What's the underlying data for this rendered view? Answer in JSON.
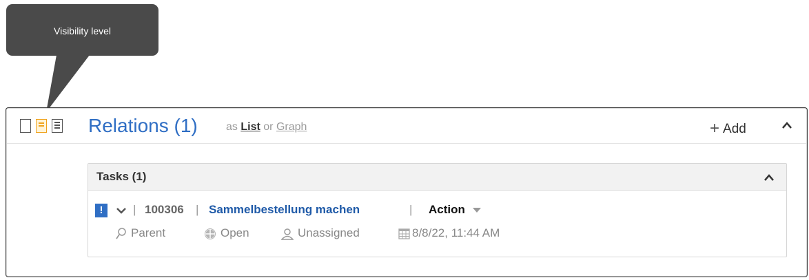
{
  "tooltip": {
    "text": "Visibility level"
  },
  "panel": {
    "title": "Relations (1)",
    "view_prefix": "as",
    "view_list": "List",
    "view_or": "or",
    "view_graph": "Graph",
    "add_label": "Add"
  },
  "tasks": {
    "title": "Tasks (1)",
    "items": [
      {
        "priority_badge": "!",
        "id": "100306",
        "name": "Sammelbestellung machen",
        "type": "Action",
        "parent_label": "Parent",
        "status": "Open",
        "assignee": "Unassigned",
        "date": "8/8/22, 11:44 AM"
      }
    ]
  },
  "colors": {
    "accent": "#2f6ec4",
    "link": "#1f5aa8",
    "active_visibility": "#f0a21c",
    "tooltip_bg": "#4a4a4a"
  }
}
